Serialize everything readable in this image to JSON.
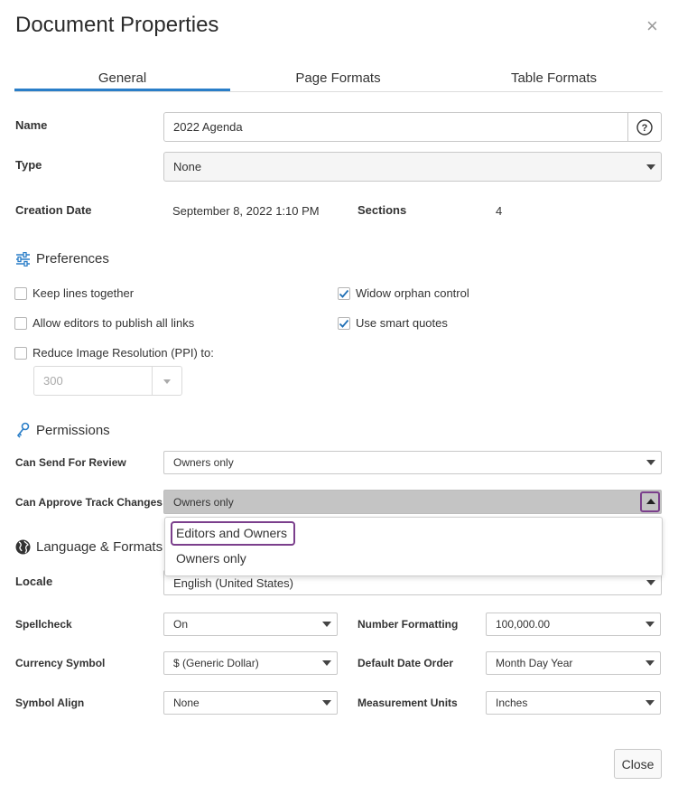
{
  "dialog": {
    "title": "Document Properties",
    "close_glyph": "×",
    "close_button": "Close"
  },
  "tabs": [
    {
      "label": "General",
      "active": true
    },
    {
      "label": "Page Formats",
      "active": false
    },
    {
      "label": "Table Formats",
      "active": false
    }
  ],
  "general": {
    "name_label": "Name",
    "name_value": "2022 Agenda",
    "help_icon": "question-circle-icon",
    "type_label": "Type",
    "type_value": "None",
    "creation_date_label": "Creation Date",
    "creation_date_value": "September 8, 2022 1:10 PM",
    "sections_label": "Sections",
    "sections_value": "4"
  },
  "preferences": {
    "title": "Preferences",
    "icon": "sliders-icon",
    "keep_lines": {
      "label": "Keep lines together",
      "checked": false
    },
    "allow_editors": {
      "label": "Allow editors to publish all links",
      "checked": false
    },
    "reduce_image": {
      "label": "Reduce Image Resolution (PPI) to:",
      "checked": false
    },
    "ppi_value": "300",
    "widow_orphan": {
      "label": "Widow orphan control",
      "checked": true
    },
    "smart_quotes": {
      "label": "Use smart quotes",
      "checked": true
    }
  },
  "permissions": {
    "title": "Permissions",
    "icon": "key-icon",
    "send_review_label": "Can Send For Review",
    "send_review_value": "Owners only",
    "approve_label": "Can Approve Track Changes",
    "approve_value": "Owners only",
    "approve_options": [
      "Editors and Owners",
      "Owners only"
    ]
  },
  "language": {
    "title": "Language & Formats",
    "icon": "globe-icon",
    "locale_label": "Locale",
    "locale_value": "English (United States)",
    "spellcheck_label": "Spellcheck",
    "spellcheck_value": "On",
    "number_label": "Number Formatting",
    "number_value": "100,000.00",
    "currency_label": "Currency Symbol",
    "currency_value": "$ (Generic Dollar)",
    "date_order_label": "Default Date Order",
    "date_order_value": "Month Day Year",
    "symbol_align_label": "Symbol Align",
    "symbol_align_value": "None",
    "units_label": "Measurement Units",
    "units_value": "Inches"
  },
  "colors": {
    "accent": "#2a7ec8",
    "focus": "#7b3f8c",
    "check": "#1f6fb5"
  }
}
